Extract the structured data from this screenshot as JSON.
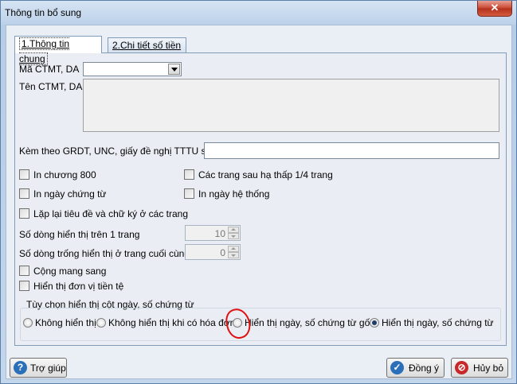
{
  "window": {
    "title": "Thông tin bổ sung",
    "close_label": "✕"
  },
  "tabs": [
    {
      "label": "1.Thông tin chung",
      "active": true
    },
    {
      "label": "2.Chi tiết số tiền",
      "active": false
    }
  ],
  "form": {
    "ma_ctmt_label": "Mã CTMT, DA",
    "ma_ctmt_value": "",
    "ten_ctmt_label": "Tên CTMT, DA",
    "ten_ctmt_value": "",
    "kem_theo_label": "Kèm theo GRDT, UNC, giấy đề nghị TTTU số",
    "kem_theo_value": ""
  },
  "checkboxes": {
    "in_chuong_800": {
      "label": "In chương 800",
      "checked": false
    },
    "cac_trang_sau": {
      "label": "Các trang sau hạ thấp 1/4 trang",
      "checked": false
    },
    "in_ngay_chung_tu": {
      "label": "In ngày chứng từ",
      "checked": false
    },
    "in_ngay_he_thong": {
      "label": "In ngày hệ thống",
      "checked": false
    },
    "lap_lai_tieu_de": {
      "label": "Lặp lại tiêu đề và chữ ký ở các trang",
      "checked": false
    },
    "cong_mang_sang": {
      "label": "Cộng mang sang",
      "checked": false
    },
    "hien_thi_don_vi": {
      "label": "Hiển thị đơn vị tiền tệ",
      "checked": false
    }
  },
  "spinners": {
    "so_dong_hien_thi": {
      "label": "Số dòng hiển thị trên 1 trang",
      "value": "10"
    },
    "so_dong_trong": {
      "label": "Số dòng trống hiển thị ở trang cuối cùng",
      "value": "0"
    }
  },
  "date_options": {
    "group_label": "Tùy chọn hiển thị cột ngày, số chứng từ",
    "options": [
      {
        "label": "Không hiển thị",
        "checked": false
      },
      {
        "label": "Không hiển thị khi có hóa đơn",
        "checked": false
      },
      {
        "label": "Hiển thị ngày, số chứng từ gốc",
        "checked": false
      },
      {
        "label": "Hiển thị ngày, số chứng từ",
        "checked": true
      }
    ]
  },
  "buttons": {
    "help": "Trợ giúp",
    "ok": "Đồng ý",
    "cancel": "Hủy bỏ"
  },
  "colors": {
    "annotation": "#e01010",
    "ok_icon": "#2a6fb8",
    "cancel_icon": "#c8282a",
    "help_icon": "#2a6fb8"
  }
}
